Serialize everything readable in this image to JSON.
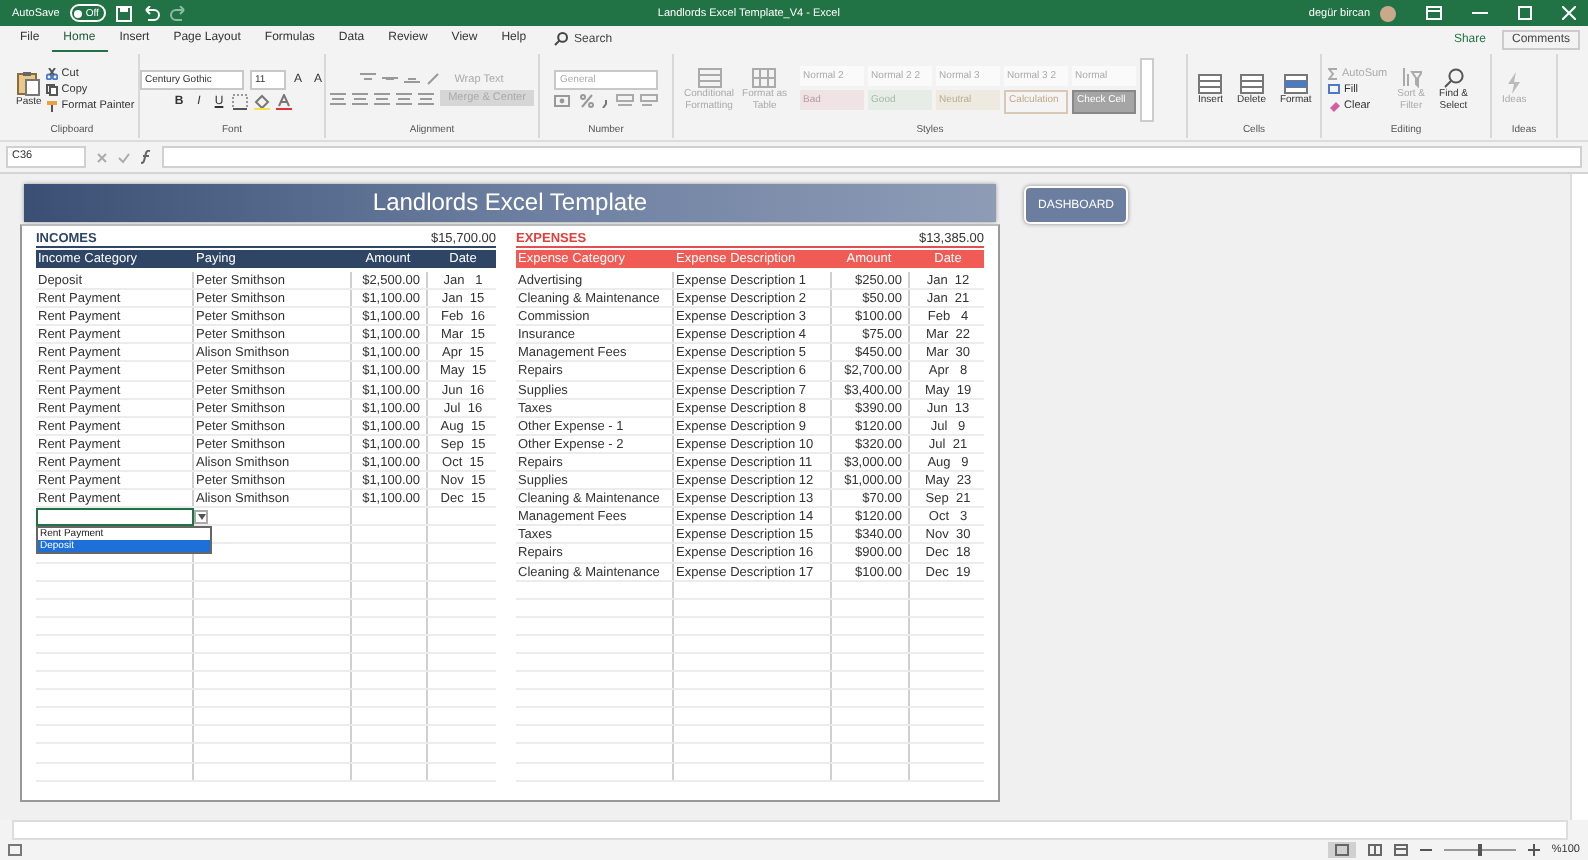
{
  "title_bar": {
    "autosave_label": "AutoSave",
    "autosave": {
      "on": false,
      "state_label": "Off"
    },
    "title": "Landlords Excel Template_V4 - Excel",
    "user": "degür bircan"
  },
  "menu_tabs": [
    {
      "label": "File",
      "selected": false
    },
    {
      "label": "Home",
      "selected": true
    },
    {
      "label": "Insert",
      "selected": false
    },
    {
      "label": "Page Layout",
      "selected": false
    },
    {
      "label": "Formulas",
      "selected": false
    },
    {
      "label": "Data",
      "selected": false
    },
    {
      "label": "Review",
      "selected": false
    },
    {
      "label": "View",
      "selected": false
    },
    {
      "label": "Help",
      "selected": false
    }
  ],
  "search": {
    "placeholder": "Search"
  },
  "share": "Share",
  "comments": "Comments",
  "ribbon": {
    "clipboard": {
      "paste": "Paste",
      "cut": "Cut",
      "copy": "Copy",
      "format_painter": "Format Painter",
      "label": "Clipboard"
    },
    "font": {
      "font_name": "Century Gothic",
      "font_size": "11",
      "size_buttons": [
        "A",
        "A"
      ],
      "style_buttons": [
        "B",
        "I",
        "U"
      ],
      "label": "Font"
    },
    "alignment": {
      "wrap_text": "Wrap Text",
      "merge": "Merge & Center",
      "label": "Alignment"
    },
    "number": {
      "format": "General",
      "label": "Number"
    },
    "styles": {
      "conditional": [
        "Conditional",
        "Formatting"
      ],
      "format_table": [
        "Format as",
        "Table"
      ],
      "cells": [
        {
          "label": "Normal 2",
          "kind": "normal"
        },
        {
          "label": "Normal 2 2",
          "kind": "normal"
        },
        {
          "label": "Normal 3",
          "kind": "normal"
        },
        {
          "label": "Normal 3 2",
          "kind": "normal"
        },
        {
          "label": "Normal",
          "kind": "normal"
        },
        {
          "label": "Bad",
          "kind": "bad"
        },
        {
          "label": "Good",
          "kind": "good"
        },
        {
          "label": "Neutral",
          "kind": "neutral"
        },
        {
          "label": "Calculation",
          "kind": "calculation"
        },
        {
          "label": "Check Cell",
          "kind": "check"
        }
      ],
      "label": "Styles"
    },
    "cells": {
      "buttons": [
        "Insert",
        "Delete",
        "Format"
      ],
      "label": "Cells"
    },
    "editing": {
      "autosum": "AutoSum",
      "fill": "Fill",
      "clear": "Clear",
      "sort": [
        "Sort &",
        "Filter"
      ],
      "find": [
        "Find &",
        "Select"
      ],
      "label": "Editing"
    },
    "ideas": {
      "button": "Ideas",
      "label": "Ideas"
    }
  },
  "formula_bar": {
    "name_box": "C36"
  },
  "sheet": {
    "banner": "Landlords Excel Template",
    "dashboard_button": "DASHBOARD",
    "incomes": {
      "title": "INCOMES",
      "total": "$15,700.00",
      "columns": [
        "Income Category",
        "Paying",
        "Amount",
        "Date"
      ],
      "rows": [
        [
          "Deposit",
          "Peter Smithson",
          "$2,500.00",
          "Jan   1"
        ],
        [
          "Rent Payment",
          "Peter Smithson",
          "$1,100.00",
          "Jan  15"
        ],
        [
          "Rent Payment",
          "Peter Smithson",
          "$1,100.00",
          "Feb  16"
        ],
        [
          "Rent Payment",
          "Peter Smithson",
          "$1,100.00",
          "Mar  15"
        ],
        [
          "Rent Payment",
          "Alison Smithson",
          "$1,100.00",
          "Apr  15"
        ],
        [
          "Rent Payment",
          "Peter Smithson",
          "$1,100.00",
          "May  15"
        ],
        [
          "Rent Payment",
          "Peter Smithson",
          "$1,100.00",
          "Jun  16"
        ],
        [
          "Rent Payment",
          "Peter Smithson",
          "$1,100.00",
          "Jul  16"
        ],
        [
          "Rent Payment",
          "Peter Smithson",
          "$1,100.00",
          "Aug  15"
        ],
        [
          "Rent Payment",
          "Peter Smithson",
          "$1,100.00",
          "Sep  15"
        ],
        [
          "Rent Payment",
          "Alison Smithson",
          "$1,100.00",
          "Oct  15"
        ],
        [
          "Rent Payment",
          "Peter Smithson",
          "$1,100.00",
          "Nov  15"
        ],
        [
          "Rent Payment",
          "Alison Smithson",
          "$1,100.00",
          "Dec  15"
        ]
      ],
      "dropdown_options": [
        {
          "label": "Rent Payment",
          "selected": false
        },
        {
          "label": "Deposit",
          "selected": true
        }
      ]
    },
    "expenses": {
      "title": "EXPENSES",
      "total": "$13,385.00",
      "columns": [
        "Expense Category",
        "Expense Description",
        "Amount",
        "Date"
      ],
      "rows": [
        [
          "Advertising",
          "Expense Description 1",
          "$250.00",
          "Jan  12"
        ],
        [
          "Cleaning & Maintenance",
          "Expense Description 2",
          "$50.00",
          "Jan  21"
        ],
        [
          "Commission",
          "Expense Description 3",
          "$100.00",
          "Feb   4"
        ],
        [
          "Insurance",
          "Expense Description 4",
          "$75.00",
          "Mar  22"
        ],
        [
          "Management Fees",
          "Expense Description 5",
          "$450.00",
          "Mar  30"
        ],
        [
          "Repairs",
          "Expense Description 6",
          "$2,700.00",
          "Apr   8"
        ],
        [
          "Supplies",
          "Expense Description 7",
          "$3,400.00",
          "May  19"
        ],
        [
          "Taxes",
          "Expense Description 8",
          "$390.00",
          "Jun  13"
        ],
        [
          "Other Expense - 1",
          "Expense Description 9",
          "$120.00",
          "Jul   9"
        ],
        [
          "Other Expense - 2",
          "Expense Description 10",
          "$320.00",
          "Jul  21"
        ],
        [
          "Repairs",
          "Expense Description 11",
          "$3,000.00",
          "Aug   9"
        ],
        [
          "Supplies",
          "Expense Description 12",
          "$1,000.00",
          "May  23"
        ],
        [
          "Cleaning & Maintenance",
          "Expense Description 13",
          "$70.00",
          "Sep  21"
        ],
        [
          "Management Fees",
          "Expense Description 14",
          "$120.00",
          "Oct   3"
        ],
        [
          "Taxes",
          "Expense Description 15",
          "$340.00",
          "Nov  30"
        ],
        [
          "Repairs",
          "Expense Description 16",
          "$900.00",
          "Dec  18"
        ],
        [
          "Cleaning & Maintenance",
          "Expense Description 17",
          "$100.00",
          "Dec  19"
        ]
      ]
    }
  },
  "status_bar": {
    "zoom_slider": {
      "level": 0.5
    },
    "zoom": "%100"
  }
}
